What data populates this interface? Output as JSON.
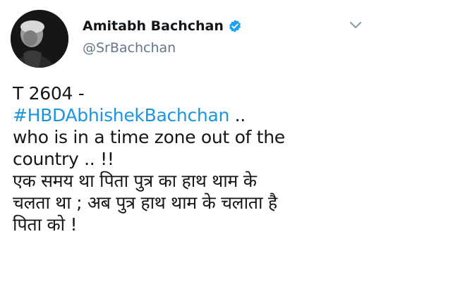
{
  "tweet": {
    "author": {
      "display_name": "Amitabh Bachchan",
      "handle": "@SrBachchan",
      "verified": true,
      "avatar_icon": "profile-photo"
    },
    "menu_icon": "chevron-down-icon",
    "body": {
      "line1": "T 2604 -",
      "hashtag": "#HBDAbhishekBachchan",
      "hashtag_suffix": " ..",
      "line3": "who is in a time zone out of the",
      "line4": "country .. !!",
      "line5": "एक समय था पिता पुत्र का हाथ थाम के",
      "line6": "चलता था ; अब पुत्र हाथ थाम के चलाता है",
      "line7": "पिता को !"
    },
    "colors": {
      "hashtag": "#1b95e0",
      "handle": "#657786",
      "verified_badge": "#1da1f2",
      "text": "#14171a"
    }
  }
}
